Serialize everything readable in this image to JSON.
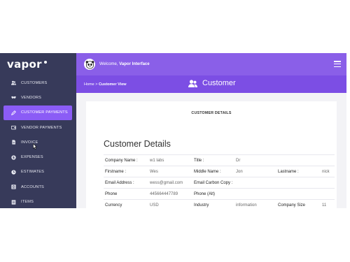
{
  "sidebar": {
    "logo": "vapor",
    "items": [
      {
        "label": "CUSTOMERS",
        "icon": "users-icon"
      },
      {
        "label": "VENDORS",
        "icon": "handshake-icon"
      },
      {
        "label": "CUSTOMER PAYMENTS",
        "icon": "pen-icon",
        "active": true
      },
      {
        "label": "VENDOR PAYMENTS",
        "icon": "wallet-icon"
      },
      {
        "label": "INVOICE",
        "icon": "document-icon"
      },
      {
        "label": "EXPENSES",
        "icon": "dollar-icon"
      },
      {
        "label": "ESTIMATES",
        "icon": "clock-icon"
      },
      {
        "label": "ACCOUNTS",
        "icon": "bank-icon"
      },
      {
        "label": "ITEMS",
        "icon": "list-icon"
      }
    ]
  },
  "topbar": {
    "welcome_prefix": "Welcome,",
    "welcome_name": "Vapor Interface"
  },
  "breadcrumb": {
    "home": "Home",
    "separator": ">",
    "current": "Customer View"
  },
  "page_title": "Customer",
  "card": {
    "header": "CUSTOMER DETAILS",
    "title": "Customer Details",
    "rows": [
      [
        "Company Name :",
        "w1 labs",
        "Title :",
        "Dr",
        "",
        ""
      ],
      [
        "Firstname :",
        "Wes",
        "Middle Name :",
        "Jon",
        "Lastname :",
        "nick"
      ],
      [
        "Email Address :",
        "wess@gmail.com",
        "Email Carbon Copy :",
        "",
        "",
        ""
      ],
      [
        "Phone",
        "445664447789",
        "Phone (Alt)",
        "",
        "",
        ""
      ],
      [
        "Currency",
        "USD",
        "Industry",
        "information",
        "Company Size",
        "11"
      ]
    ]
  },
  "colors": {
    "sidebar": "#373a5a",
    "active": "#8b5cf6",
    "topbar": "#8a5fe8",
    "subbar": "#7c4ee4"
  }
}
